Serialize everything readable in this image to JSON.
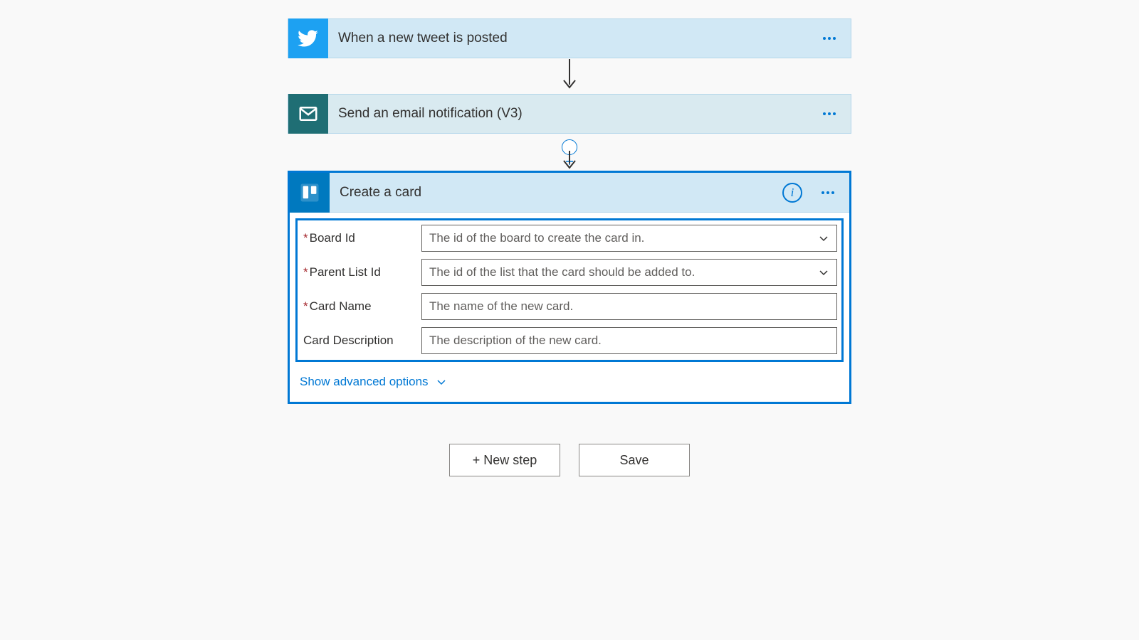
{
  "steps": {
    "twitter": {
      "title": "When a new tweet is posted"
    },
    "email": {
      "title": "Send an email notification (V3)"
    },
    "trello": {
      "title": "Create a card"
    }
  },
  "form": {
    "board_id": {
      "label": "Board Id",
      "placeholder": "The id of the board to create the card in.",
      "required": true
    },
    "parent_list": {
      "label": "Parent List Id",
      "placeholder": "The id of the list that the card should be added to.",
      "required": true
    },
    "card_name": {
      "label": "Card Name",
      "placeholder": "The name of the new card.",
      "required": true
    },
    "card_desc": {
      "label": "Card Description",
      "placeholder": "The description of the new card.",
      "required": false
    }
  },
  "advanced_label": "Show advanced options",
  "buttons": {
    "new_step": "+ New step",
    "save": "Save"
  }
}
